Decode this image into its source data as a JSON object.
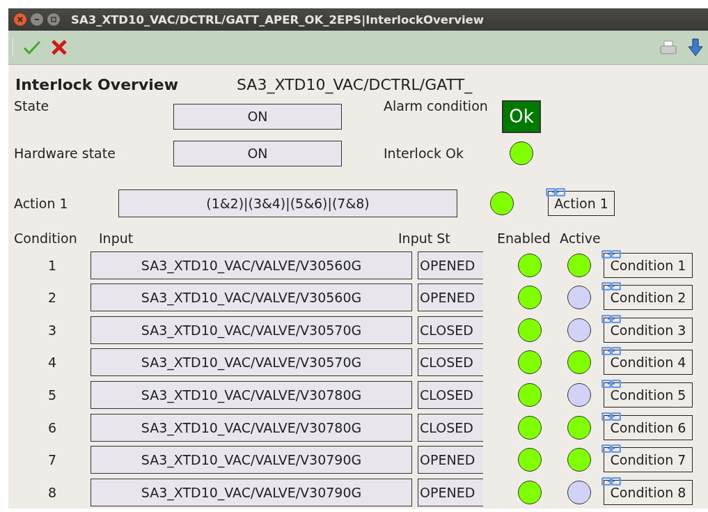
{
  "window": {
    "title": "SA3_XTD10_VAC/DCTRL/GATT_APER_OK_2EPS|InterlockOverview"
  },
  "heading": "Interlock Overview",
  "device_name": "SA3_XTD10_VAC/DCTRL/GATT_",
  "state": {
    "label": "State",
    "value": "ON"
  },
  "hardware_state": {
    "label": "Hardware state",
    "value": "ON"
  },
  "alarm_condition": {
    "label": "Alarm condition",
    "value": "Ok"
  },
  "interlock_ok": {
    "label": "Interlock Ok",
    "on": true
  },
  "action": {
    "label": "Action 1",
    "expression": "(1&2)|(3&4)|(5&6)|(7&8)",
    "on": true,
    "button": "Action 1"
  },
  "columns": [
    "Condition",
    "Input",
    "Input St",
    "Enabled",
    "Active"
  ],
  "conditions": [
    {
      "number": "1",
      "input": "SA3_XTD10_VAC/VALVE/V30560G",
      "input_state": "OPENED",
      "enabled": true,
      "active": true,
      "button": "Condition 1"
    },
    {
      "number": "2",
      "input": "SA3_XTD10_VAC/VALVE/V30560G",
      "input_state": "OPENED",
      "enabled": true,
      "active": false,
      "button": "Condition 2"
    },
    {
      "number": "3",
      "input": "SA3_XTD10_VAC/VALVE/V30570G",
      "input_state": "CLOSED",
      "enabled": true,
      "active": false,
      "button": "Condition 3"
    },
    {
      "number": "4",
      "input": "SA3_XTD10_VAC/VALVE/V30570G",
      "input_state": "CLOSED",
      "enabled": true,
      "active": true,
      "button": "Condition 4"
    },
    {
      "number": "5",
      "input": "SA3_XTD10_VAC/VALVE/V30780G",
      "input_state": "CLOSED",
      "enabled": true,
      "active": false,
      "button": "Condition 5"
    },
    {
      "number": "6",
      "input": "SA3_XTD10_VAC/VALVE/V30780G",
      "input_state": "CLOSED",
      "enabled": true,
      "active": true,
      "button": "Condition 6"
    },
    {
      "number": "7",
      "input": "SA3_XTD10_VAC/VALVE/V30790G",
      "input_state": "OPENED",
      "enabled": true,
      "active": true,
      "button": "Condition 7"
    },
    {
      "number": "8",
      "input": "SA3_XTD10_VAC/VALVE/V30790G",
      "input_state": "OPENED",
      "enabled": true,
      "active": false,
      "button": "Condition 8"
    }
  ]
}
